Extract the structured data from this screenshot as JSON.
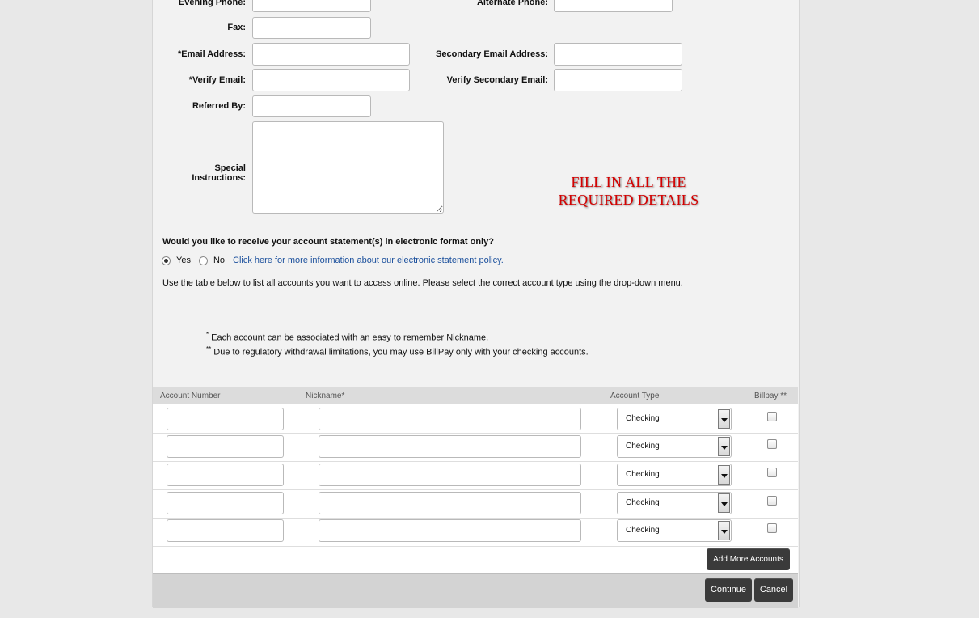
{
  "fields": {
    "evening_phone_label": "Evening Phone:",
    "alternate_phone_label": "Alternate Phone:",
    "fax_label": "Fax:",
    "email_label": "*Email Address:",
    "secondary_email_label": "Secondary Email Address:",
    "verify_email_label": "*Verify Email:",
    "verify_secondary_email_label": "Verify Secondary Email:",
    "referred_by_label": "Referred By:",
    "special_instructions_label": "Special Instructions:"
  },
  "banner": {
    "line1": "FILL IN ALL THE",
    "line2": "REQUIRED DETAILS",
    "color": "#d40000"
  },
  "statement": {
    "question": "Would you like to receive your account statement(s) in electronic format only?",
    "yes_label": "Yes",
    "no_label": "No",
    "selected": "Yes",
    "policy_link": "Click here for more information about our electronic statement policy."
  },
  "instructions": "Use the table below to list all accounts you want to access online. Please select the correct account type using the drop-down menu.",
  "notes": {
    "note1_mark": "*",
    "note1_text": " Each account can be associated with an easy to remember Nickname.",
    "note2_mark": "**",
    "note2_text": " Due to regulatory withdrawal limitations, you may use BillPay only with your checking accounts."
  },
  "table": {
    "headers": {
      "account_number": "Account Number",
      "nickname": "Nickname*",
      "account_type": "Account Type",
      "billpay": "Billpay **"
    },
    "rows": [
      {
        "account_number": "",
        "nickname": "",
        "account_type": "Checking",
        "billpay": false
      },
      {
        "account_number": "",
        "nickname": "",
        "account_type": "Checking",
        "billpay": false
      },
      {
        "account_number": "",
        "nickname": "",
        "account_type": "Checking",
        "billpay": false
      },
      {
        "account_number": "",
        "nickname": "",
        "account_type": "Checking",
        "billpay": false
      },
      {
        "account_number": "",
        "nickname": "",
        "account_type": "Checking",
        "billpay": false
      }
    ]
  },
  "buttons": {
    "add_more": "Add More Accounts",
    "continue": "Continue",
    "cancel": "Cancel"
  },
  "colors": {
    "link": "#1a4f9c",
    "button": "#3a3a3a"
  }
}
